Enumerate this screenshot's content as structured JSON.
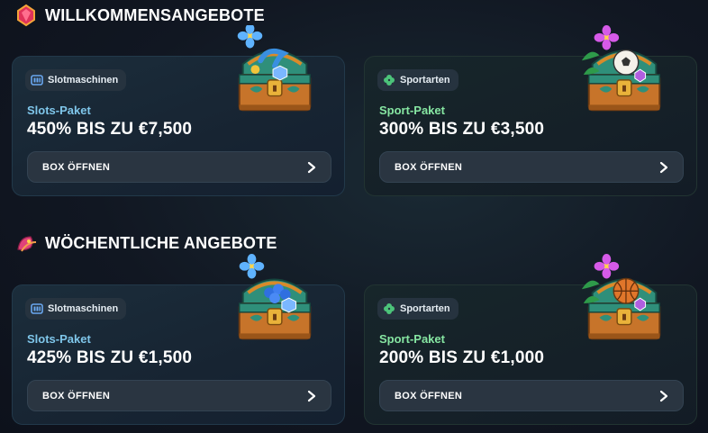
{
  "sections": [
    {
      "title": "WILLKOMMENSANGEBOTE",
      "icon": "gem-icon",
      "cards": [
        {
          "category": "Slotmaschinen",
          "category_icon": "slot-machine-icon",
          "package": "Slots-Paket",
          "offer": "450% BIS ZU €7,500",
          "button": "BOX ÖFFNEN"
        },
        {
          "category": "Sportarten",
          "category_icon": "clover-icon",
          "package": "Sport-Paket",
          "offer": "300% BIS ZU €3,500",
          "button": "BOX ÖFFNEN"
        }
      ]
    },
    {
      "title": "WÖCHENTLICHE ANGEBOTE",
      "icon": "flower-icon",
      "cards": [
        {
          "category": "Slotmaschinen",
          "category_icon": "slot-machine-icon",
          "package": "Slots-Paket",
          "offer": "425% BIS ZU €1,500",
          "button": "BOX ÖFFNEN"
        },
        {
          "category": "Sportarten",
          "category_icon": "clover-icon",
          "package": "Sport-Paket",
          "offer": "200% BIS ZU €1,000",
          "button": "BOX ÖFFNEN"
        }
      ]
    }
  ],
  "colors": {
    "slots_accent": "#7fc6ea",
    "sport_accent": "#86e6a2",
    "button_bg": "#2a3541"
  }
}
